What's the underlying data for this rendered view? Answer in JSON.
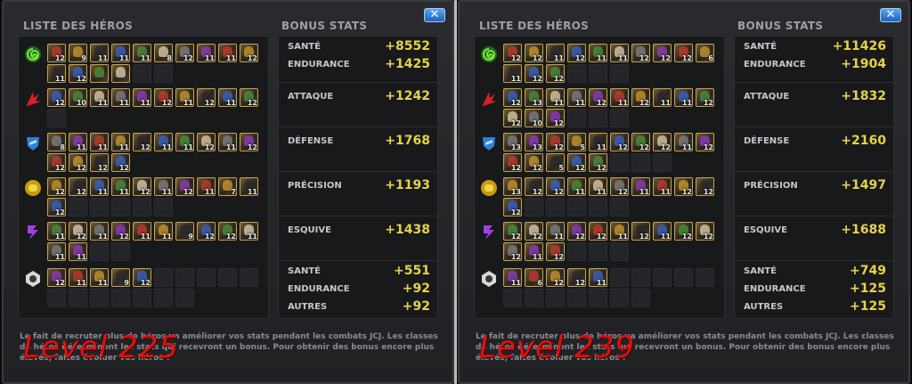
{
  "colors": {
    "accent": "#e6d24a",
    "watermark": "#e01010",
    "close": "#2a7ad0"
  },
  "class_icons": [
    "cosmic-icon",
    "mutant-icon",
    "tech-icon",
    "skill-icon",
    "mystic-icon",
    "science-icon"
  ],
  "panels": [
    {
      "header_heroes": "LISTE DES HÉROS",
      "header_bonus": "BONUS STATS",
      "close_label": "✕",
      "watermark": "Level 225",
      "footer": "Le fait de recruter plus de héros va améliorer vos stats pendant les combats JCJ. Les classes de héros déterminent les stats qui recevront un bonus. Pour obtenir des bonus encore plus élevés, faites évoluer vos héros !",
      "rows": [
        {
          "levels": [
            "12",
            "9",
            "11",
            "11",
            "11",
            "8",
            "12",
            "11",
            "11",
            "12",
            "11",
            "12",
            "",
            ""
          ],
          "empties": 2
        },
        {
          "levels": [
            "12",
            "10",
            "11",
            "11",
            "11",
            "12",
            "11",
            "12",
            "11",
            "12"
          ],
          "empties": 1
        },
        {
          "levels": [
            "8",
            "11",
            "11",
            "11",
            "12",
            "11",
            "11",
            "12",
            "11",
            "12",
            "12",
            "12",
            "12",
            "12"
          ],
          "empties": 0
        },
        {
          "levels": [
            "12",
            "12",
            "11",
            "11",
            "12",
            "11",
            "12",
            "11",
            "7",
            "11",
            "12"
          ],
          "empties": 5
        },
        {
          "levels": [
            "11",
            "12",
            "11",
            "12",
            "11",
            "11",
            "9",
            "12",
            "12",
            "11",
            "11",
            "11"
          ],
          "empties": 2
        },
        {
          "levels": [
            "12",
            "11",
            "11",
            "9",
            "12"
          ],
          "empties": 12
        }
      ],
      "stats": [
        {
          "lines": [
            {
              "name": "SANTÉ",
              "value": "+8552"
            },
            {
              "name": "ENDURANCE",
              "value": "+1425"
            }
          ]
        },
        {
          "lines": [
            {
              "name": "ATTAQUE",
              "value": "+1242"
            }
          ]
        },
        {
          "lines": [
            {
              "name": "DÉFENSE",
              "value": "+1768"
            }
          ]
        },
        {
          "lines": [
            {
              "name": "PRÉCISION",
              "value": "+1193"
            }
          ]
        },
        {
          "lines": [
            {
              "name": "ESQUIVE",
              "value": "+1438"
            }
          ]
        },
        {
          "lines": [
            {
              "name": "SANTÉ",
              "value": "+551"
            },
            {
              "name": "ENDURANCE",
              "value": "+92"
            },
            {
              "name": "AUTRES",
              "value": "+92"
            }
          ]
        }
      ]
    },
    {
      "header_heroes": "LISTE DES HÉROS",
      "header_bonus": "BONUS STATS",
      "close_label": "✕",
      "watermark": "Level 239",
      "footer": "Le fait de recruter plus de héros va améliorer vos stats pendant les combats JCJ. Les classes de héros déterminent les stats qui recevront un bonus. Pour obtenir des bonus encore plus élevés, faites évoluer vos héros !",
      "rows": [
        {
          "levels": [
            "12",
            "12",
            "11",
            "12",
            "11",
            "11",
            "12",
            "12",
            "12",
            "6",
            "11",
            "12",
            "12"
          ],
          "empties": 3
        },
        {
          "levels": [
            "12",
            "13",
            "11",
            "11",
            "12",
            "11",
            "12",
            "11",
            "11",
            "12",
            "12",
            "10",
            "12"
          ],
          "empties": 3
        },
        {
          "levels": [
            "13",
            "13",
            "12",
            "5",
            "11",
            "12",
            "12",
            "12",
            "11",
            "12",
            "12",
            "12",
            "5",
            "12",
            "12"
          ],
          "empties": 3
        },
        {
          "levels": [
            "13",
            "12",
            "12",
            "11",
            "11",
            "12",
            "11",
            "11",
            "12",
            "12",
            "12"
          ],
          "empties": 5
        },
        {
          "levels": [
            "12",
            "12",
            "11",
            "12",
            "12",
            "11",
            "12",
            "11",
            "12",
            "12",
            "12",
            "11",
            "12"
          ],
          "empties": 3
        },
        {
          "levels": [
            "11",
            "6",
            "12",
            "12",
            "11"
          ],
          "empties": 12
        }
      ],
      "stats": [
        {
          "lines": [
            {
              "name": "SANTÉ",
              "value": "+11426"
            },
            {
              "name": "ENDURANCE",
              "value": "+1904"
            }
          ]
        },
        {
          "lines": [
            {
              "name": "ATTAQUE",
              "value": "+1832"
            }
          ]
        },
        {
          "lines": [
            {
              "name": "DÉFENSE",
              "value": "+2160"
            }
          ]
        },
        {
          "lines": [
            {
              "name": "PRÉCISION",
              "value": "+1497"
            }
          ]
        },
        {
          "lines": [
            {
              "name": "ESQUIVE",
              "value": "+1688"
            }
          ]
        },
        {
          "lines": [
            {
              "name": "SANTÉ",
              "value": "+749"
            },
            {
              "name": "ENDURANCE",
              "value": "+125"
            },
            {
              "name": "AUTRES",
              "value": "+125"
            }
          ]
        }
      ]
    }
  ]
}
